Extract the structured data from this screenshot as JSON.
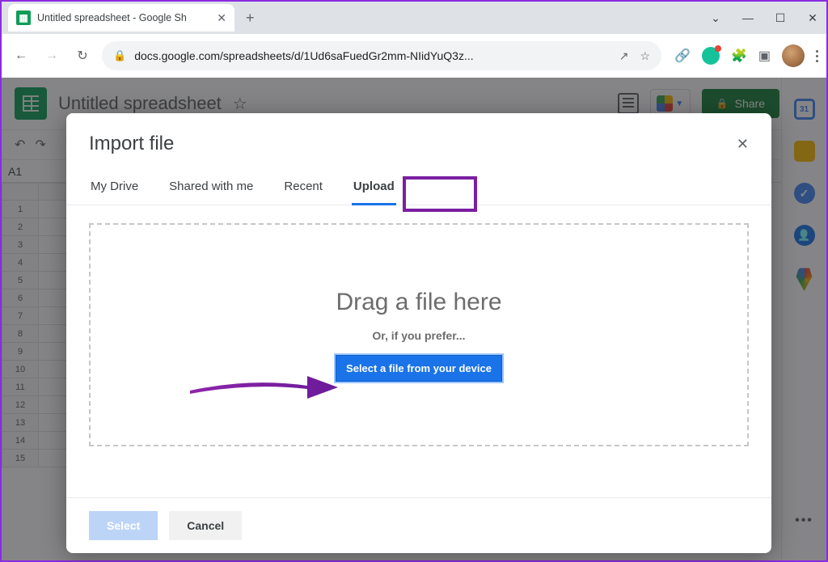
{
  "browser": {
    "tab_title": "Untitled spreadsheet - Google Sh",
    "new_tab_glyph": "+",
    "tab_close_glyph": "✕",
    "window": {
      "dropdown": "⌄",
      "min": "—",
      "max": "☐",
      "close": "✕"
    },
    "nav": {
      "back": "←",
      "forward": "→",
      "reload": "↻"
    },
    "lock_glyph": "🔒",
    "url": "docs.google.com/spreadsheets/d/1Ud6saFuedGr2mm-NIidYuQ3z...",
    "share_glyph": "↗",
    "star_glyph": "☆",
    "link_glyph": "🔗",
    "ext_puzzle": "🧩",
    "ext_reader": "▣",
    "kebab": "⋮"
  },
  "app": {
    "doc_title": "Untitled spreadsheet",
    "star_glyph": "☆",
    "share_label": "Share",
    "share_lock": "🔒",
    "undo_glyph": "↶",
    "redo_glyph": "↷",
    "name_box": "A1",
    "row_numbers": [
      "1",
      "2",
      "3",
      "4",
      "5",
      "6",
      "7",
      "8",
      "9",
      "10",
      "11",
      "12",
      "13",
      "14",
      "15"
    ]
  },
  "modal": {
    "title": "Import file",
    "close_glyph": "✕",
    "tabs": {
      "drive": "My Drive",
      "shared": "Shared with me",
      "recent": "Recent",
      "upload": "Upload"
    },
    "dropzone": {
      "headline": "Drag a file here",
      "subline": "Or, if you prefer...",
      "button": "Select a file from your device"
    },
    "footer": {
      "select": "Select",
      "cancel": "Cancel"
    }
  },
  "sidepanel": {
    "more": "•••"
  },
  "annotations": {
    "highlight": "upload-tab",
    "arrow_target": "select-file-button",
    "accent_color": "#7b1fa2"
  }
}
